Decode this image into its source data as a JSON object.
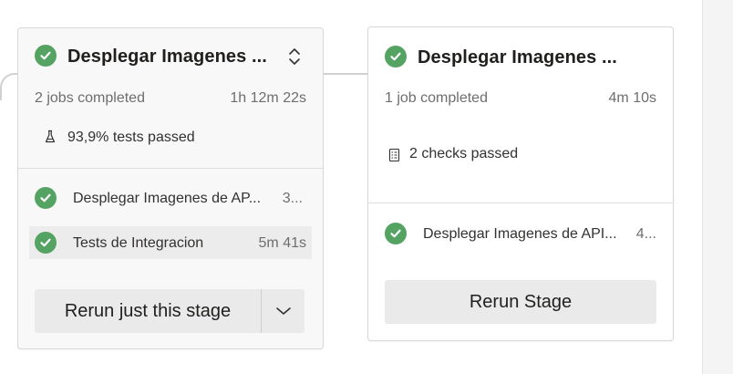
{
  "stages": [
    {
      "title": "Desplegar Imagenes ...",
      "jobs_summary": "2 jobs completed",
      "duration": "1h 12m 22s",
      "extra": "93,9% tests passed",
      "extra_icon": "flask-icon",
      "jobs": [
        {
          "name": "Desplegar Imagenes de AP...",
          "time": "3..."
        },
        {
          "name": "Tests de Integracion",
          "time": "5m 41s"
        }
      ],
      "button_label": "Rerun just this stage"
    },
    {
      "title": "Desplegar Imagenes ...",
      "jobs_summary": "1 job completed",
      "duration": "4m 10s",
      "extra": "2 checks passed",
      "extra_icon": "checklist-icon",
      "jobs": [
        {
          "name": "Desplegar Imagenes de API...",
          "time": "4..."
        }
      ],
      "button_label": "Rerun Stage"
    }
  ],
  "colors": {
    "success": "#55a362",
    "connector": "#d1d1d1",
    "button_bg": "#eaeaea"
  }
}
